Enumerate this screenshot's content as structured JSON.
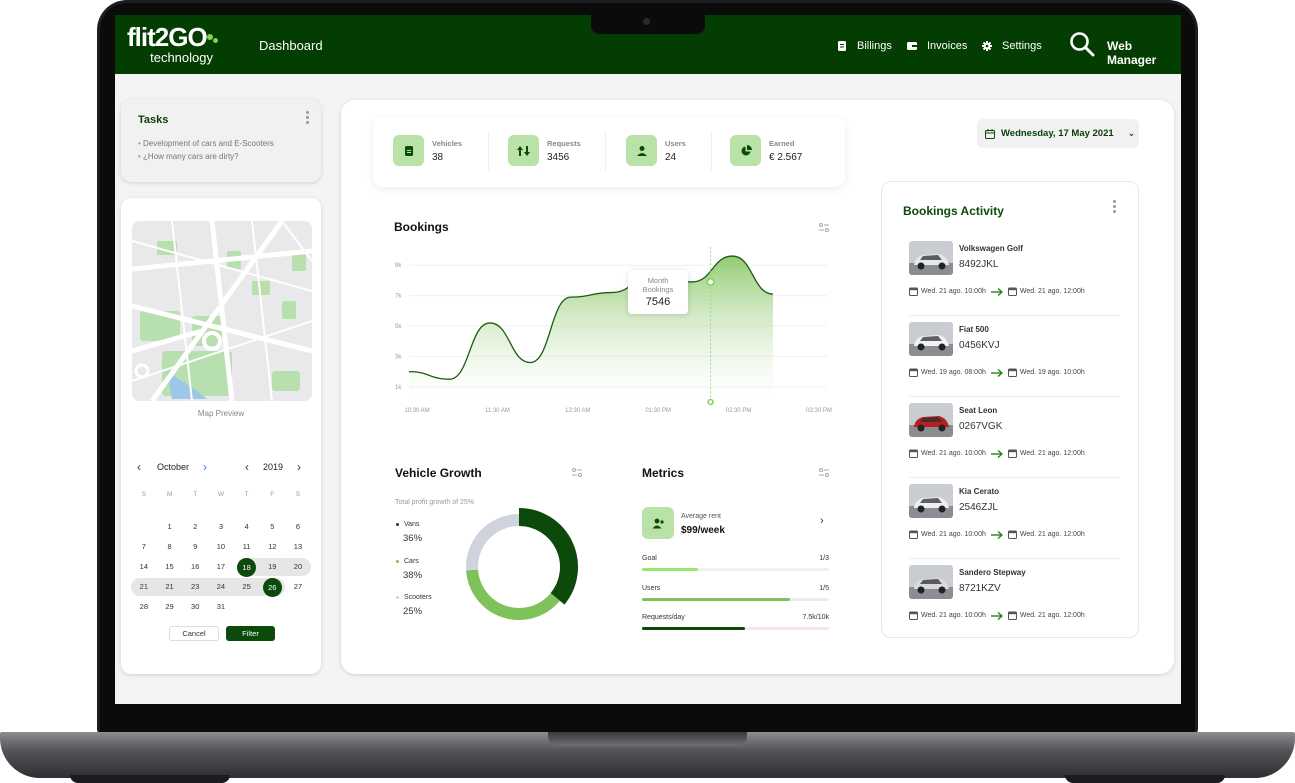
{
  "app": {
    "logo_main": "flit2GO",
    "logo_sub": "technology",
    "page_title": "Dashboard",
    "user": "Web Manager",
    "brand_color": "#033d02",
    "accent_color": "#7fd35a"
  },
  "nav": [
    {
      "label": "Billings",
      "icon": "billing-icon"
    },
    {
      "label": "Invoices",
      "icon": "invoice-icon"
    },
    {
      "label": "Settings",
      "icon": "gear-icon"
    }
  ],
  "tasks": {
    "title": "Tasks",
    "items": [
      "Development of cars and E-Scooters",
      "¿How many cars are dirty?"
    ]
  },
  "map": {
    "caption": "Map Preview"
  },
  "calendar": {
    "month": "October",
    "year": "2019",
    "dow": [
      "S",
      "M",
      "T",
      "W",
      "T",
      "F",
      "S"
    ],
    "weeks": [
      [
        "",
        "1",
        "2",
        "3",
        "4",
        "5",
        "6"
      ],
      [
        "7",
        "8",
        "9",
        "10",
        "11",
        "12",
        "13"
      ],
      [
        "14",
        "15",
        "16",
        "17",
        "18",
        "19",
        "20"
      ],
      [
        "21",
        "21",
        "23",
        "24",
        "25",
        "26",
        "27"
      ],
      [
        "28",
        "29",
        "30",
        "31",
        "",
        "",
        ""
      ]
    ],
    "selected": [
      "18",
      "26"
    ],
    "cancel": "Cancel",
    "filter": "Filter"
  },
  "stats": [
    {
      "label": "Vehicles",
      "value": "38",
      "icon": "document-icon"
    },
    {
      "label": "Requests",
      "value": "3456",
      "icon": "requests-icon"
    },
    {
      "label": "Users",
      "value": "24",
      "icon": "user-icon"
    },
    {
      "label": "Earned",
      "value": "€ 2.567",
      "icon": "pie-icon"
    }
  ],
  "date": "Wednesday, 17 May 2021",
  "bookings": {
    "title": "Bookings",
    "tooltip_label_1": "Month",
    "tooltip_label_2": "Bookings",
    "tooltip_value": "7546"
  },
  "chart_data": {
    "type": "area",
    "title": "Bookings",
    "x": [
      "10:30 AM",
      "11:30 AM",
      "12:30 AM",
      "01:30 PM",
      "02:30 PM",
      "03:30 PM"
    ],
    "yticks": [
      "1k",
      "3k",
      "5k",
      "7k",
      "9k"
    ],
    "ylim": [
      0,
      10000
    ],
    "series": [
      {
        "values": [
          2000,
          1500,
          5200,
          2600,
          6900,
          7200,
          8200,
          7900,
          9600,
          7100
        ]
      }
    ],
    "highlight": {
      "x": "02:30 PM",
      "label": "Month Bookings",
      "value": 7546
    },
    "grid": true
  },
  "vehicle_growth": {
    "title": "Vehicle Growth",
    "subtitle": "Total profit growth of 25%",
    "items": [
      {
        "name": "Vans",
        "value": "36%",
        "pct": 36,
        "color": "#0b4a0a"
      },
      {
        "name": "Cars",
        "value": "38%",
        "pct": 38,
        "color": "#7fc25a"
      },
      {
        "name": "Scooters",
        "value": "25%",
        "pct": 26,
        "color": "#cfd4dc"
      }
    ]
  },
  "metrics": {
    "title": "Metrics",
    "avg_label": "Average rent",
    "avg_value": "$99/week",
    "bars": [
      {
        "label": "Goal",
        "value": "1/3",
        "fill": 0.3,
        "color": "#97e86f",
        "track": "#f6ede8"
      },
      {
        "label": "Users",
        "value": "1/5",
        "fill": 0.79,
        "color": "#7fc25a",
        "track": "#e9edf2"
      },
      {
        "label": "Requests/day",
        "value": "7.5k/10k",
        "fill": 0.55,
        "color": "#0b4a0a",
        "track": "#f6e6e6"
      }
    ]
  },
  "activity": {
    "title": "Bookings Activity",
    "items": [
      {
        "car": "Volkswagen Golf",
        "plate": "8492JKL",
        "from": "Wed. 21 ago. 10:00h",
        "to": "Wed. 21 ago. 12:00h",
        "color": "#e8e8e8"
      },
      {
        "car": "Fiat 500",
        "plate": "0456KVJ",
        "from": "Wed. 19 ago. 08:00h",
        "to": "Wed. 19 ago. 10:00h",
        "color": "#f2f2f2"
      },
      {
        "car": "Seat Leon",
        "plate": "0267VGK",
        "from": "Wed. 21 ago. 10:00h",
        "to": "Wed. 21 ago. 12:00h",
        "color": "#b51f1f"
      },
      {
        "car": "Kia Cerato",
        "plate": "2546ZJL",
        "from": "Wed. 21 ago. 10:00h",
        "to": "Wed. 21 ago. 12:00h",
        "color": "#eeeeee"
      },
      {
        "car": "Sandero Stepway",
        "plate": "8721KZV",
        "from": "Wed. 21 ago. 10:00h",
        "to": "Wed. 21 ago. 12:00h",
        "color": "#d9d9d9"
      }
    ]
  }
}
